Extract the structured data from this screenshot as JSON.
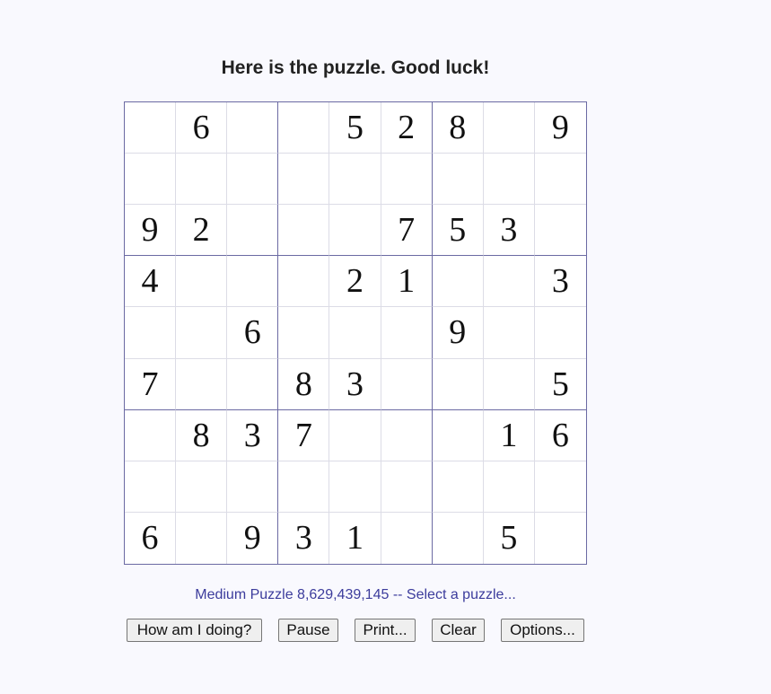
{
  "heading": "Here is the puzzle. Good luck!",
  "grid": [
    [
      "",
      "6",
      "",
      "",
      "5",
      "2",
      "8",
      "",
      "9"
    ],
    [
      "",
      "",
      "",
      "",
      "",
      "",
      "",
      "",
      ""
    ],
    [
      "9",
      "2",
      "",
      "",
      "",
      "7",
      "5",
      "3",
      ""
    ],
    [
      "4",
      "",
      "",
      "",
      "2",
      "1",
      "",
      "",
      "3"
    ],
    [
      "",
      "",
      "6",
      "",
      "",
      "",
      "9",
      "",
      ""
    ],
    [
      "7",
      "",
      "",
      "8",
      "3",
      "",
      "",
      "",
      "5"
    ],
    [
      "",
      "8",
      "3",
      "7",
      "",
      "",
      "",
      "1",
      "6"
    ],
    [
      "",
      "",
      "",
      "",
      "",
      "",
      "",
      "",
      ""
    ],
    [
      "6",
      "",
      "9",
      "3",
      "1",
      "",
      "",
      "5",
      ""
    ]
  ],
  "status": {
    "puzzle_label": "Medium Puzzle 8,629,439,145",
    "separator": " -- ",
    "select_link": "Select a puzzle..."
  },
  "buttons": {
    "how_am_i_doing": "How am I doing?",
    "pause": "Pause",
    "print": "Print...",
    "clear": "Clear",
    "options": "Options..."
  },
  "colors": {
    "background": "#f9f9fe",
    "grid_border": "#6b6aa3",
    "status_text": "#3c3c9c"
  }
}
